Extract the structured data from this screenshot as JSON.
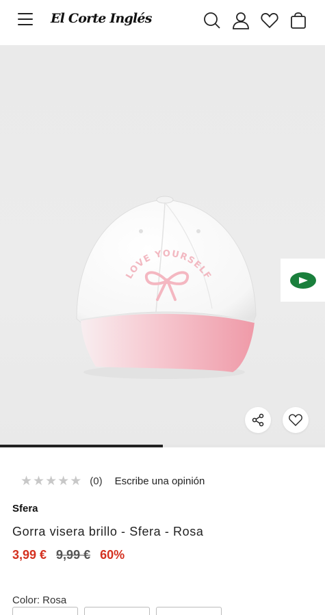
{
  "header": {
    "logo_text": "El Corte Inglés",
    "icons": [
      "menu-icon",
      "search-icon",
      "user-icon",
      "heart-icon",
      "bag-icon"
    ]
  },
  "gallery": {
    "image_description_icons": [
      "share-icon",
      "heart-icon",
      "arrow-right-icon"
    ],
    "progress_fraction": 0.5
  },
  "product": {
    "rating_count": "(0)",
    "review_link": "Escribe una opinión",
    "brand": "Sfera",
    "title": "Gorra visera brillo - Sfera - Rosa",
    "price_now": "3,99 €",
    "price_old": "9,99 €",
    "discount": "60%",
    "color_label": "Color: Rosa",
    "cap_text": "LOVE YOURSELF"
  },
  "colors": {
    "sale_red": "#d4301f",
    "star_grey": "#c8c8c8",
    "widget_green": "#1a7f3c"
  }
}
